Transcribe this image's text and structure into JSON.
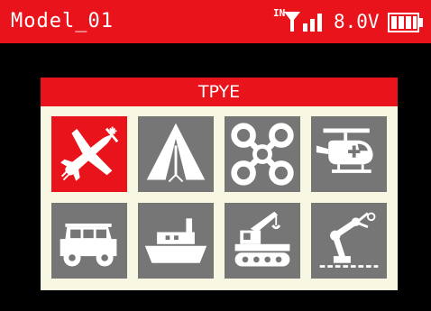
{
  "status_bar": {
    "model_name": "Model_01",
    "input_label": "IN",
    "voltage": "8.0V",
    "signal_icon": "signal-bars-icon",
    "battery_icon": "battery-full-icon"
  },
  "type_panel": {
    "title": "TPYE",
    "selected_index": 0,
    "items": [
      {
        "icon": "airplane-icon"
      },
      {
        "icon": "glider-icon"
      },
      {
        "icon": "quadcopter-icon"
      },
      {
        "icon": "helicopter-icon"
      },
      {
        "icon": "car-icon"
      },
      {
        "icon": "boat-icon"
      },
      {
        "icon": "tracked-vehicle-icon"
      },
      {
        "icon": "robot-arm-icon"
      }
    ]
  },
  "colors": {
    "accent": "#e8131b",
    "tile": "#767676",
    "panel_bg": "#f7f7e2",
    "background": "#000000"
  }
}
